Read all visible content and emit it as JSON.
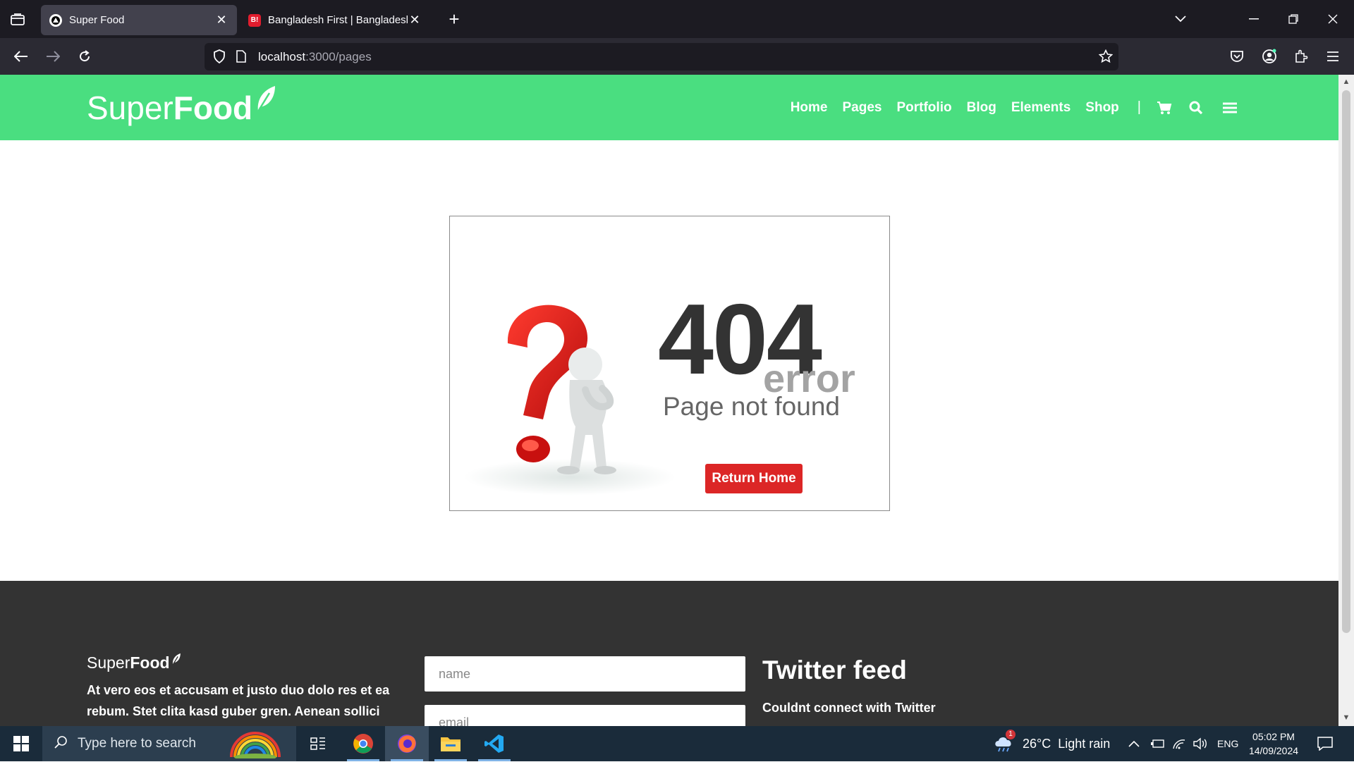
{
  "browser": {
    "tabs": [
      {
        "title": "Super Food",
        "active": true
      },
      {
        "title": "Bangladesh First | Bangladeshi N",
        "active": false
      }
    ],
    "url_host": "localhost",
    "url_path": ":3000/pages"
  },
  "site": {
    "logo_thin": "Super",
    "logo_bold": "Food",
    "nav": [
      "Home",
      "Pages",
      "Portfolio",
      "Blog",
      "Elements",
      "Shop"
    ],
    "nav_separator": "|"
  },
  "error": {
    "code": "404",
    "word": "error",
    "message": "Page not found",
    "button": "Return Home"
  },
  "footer": {
    "logo_thin": "Super",
    "logo_bold": "Food",
    "about": "At vero eos et accusam et justo duo dolo res et ea rebum. Stet clita kasd guber gren. Aenean sollici",
    "name_placeholder": "name",
    "email_placeholder": "email",
    "twitter_heading": "Twitter feed",
    "twitter_message": "Couldnt connect with Twitter"
  },
  "taskbar": {
    "search_placeholder": "Type here to search",
    "weather": "26°C  Light rain",
    "weather_badge": "1",
    "lang": "ENG",
    "time": "05:02 PM",
    "date": "14/09/2024"
  },
  "colors": {
    "header_green": "#4ade80",
    "button_red": "#dc2626",
    "footer_bg": "#333333"
  }
}
